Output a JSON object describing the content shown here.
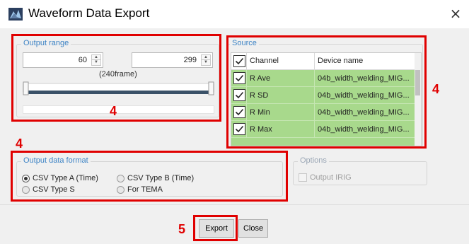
{
  "window": {
    "title": "Waveform Data Export",
    "close_glyph": "×",
    "app_icon": "waveform-app-icon"
  },
  "output_range": {
    "legend": "Output range",
    "start_value": "60",
    "end_value": "299",
    "frame_label": "(240frame)",
    "spin_up": "▲",
    "spin_down": "▼"
  },
  "source": {
    "legend": "Source",
    "header_channel": "Channel",
    "header_device": "Device name",
    "rows": [
      {
        "channel": "R Ave",
        "device": "04b_width_welding_MIG...",
        "checked": true
      },
      {
        "channel": "R SD",
        "device": "04b_width_welding_MIG...",
        "checked": true
      },
      {
        "channel": "R Min",
        "device": "04b_width_welding_MIG...",
        "checked": true
      },
      {
        "channel": "R Max",
        "device": "04b_width_welding_MIG...",
        "checked": true
      }
    ],
    "row_color": "#a8d98c"
  },
  "output_format": {
    "legend": "Output data format",
    "options": [
      {
        "label": "CSV Type A (Time)",
        "selected": true
      },
      {
        "label": "CSV Type B (Time)",
        "selected": false
      },
      {
        "label": "CSV Type S",
        "selected": false
      },
      {
        "label": "For TEMA",
        "selected": false
      }
    ]
  },
  "options": {
    "legend": "Options",
    "output_irig_label": "Output IRIG",
    "output_irig_enabled": false
  },
  "buttons": {
    "export_label": "Export",
    "close_label": "Close"
  },
  "annotations": {
    "label_range": "4",
    "label_source": "4",
    "label_format": "4",
    "label_export": "5",
    "color": "#e00000"
  }
}
